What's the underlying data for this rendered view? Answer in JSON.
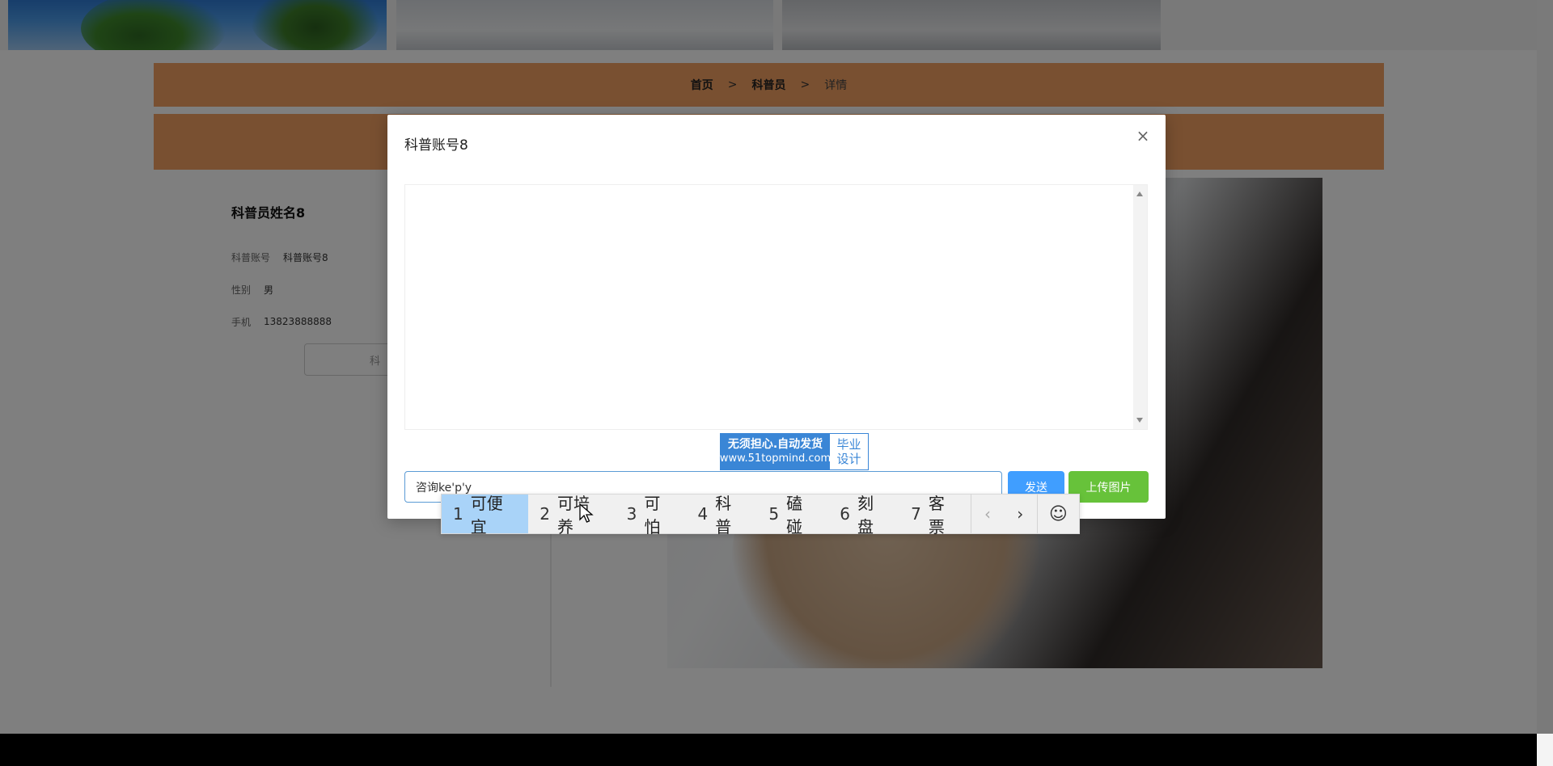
{
  "breadcrumb": {
    "home": "首页",
    "section": "科普员",
    "current": "详情",
    "separator": ">"
  },
  "profile": {
    "name": "科普员姓名8",
    "account_label": "科普账号",
    "account_value": "科普账号8",
    "gender_label": "性别",
    "gender_value": "男",
    "phone_label": "手机",
    "phone_value": "13823888888",
    "button_label": "科"
  },
  "modal": {
    "title": "科普账号8",
    "close_glyph": "×",
    "watermark": {
      "line1": "无须担心.自动发货",
      "line2": "www.51topmind.com",
      "right1": "毕业",
      "right2": "设计"
    },
    "input_value": "咨询ke'p'y",
    "send_label": "发送",
    "upload_label": "上传图片"
  },
  "ime": {
    "candidates": [
      {
        "num": "1",
        "text": "可便宜",
        "selected": true
      },
      {
        "num": "2",
        "text": "可培养",
        "selected": false
      },
      {
        "num": "3",
        "text": "可怕",
        "selected": false
      },
      {
        "num": "4",
        "text": "科普",
        "selected": false
      },
      {
        "num": "5",
        "text": "磕碰",
        "selected": false
      },
      {
        "num": "6",
        "text": "刻盘",
        "selected": false
      },
      {
        "num": "7",
        "text": "客票",
        "selected": false
      }
    ],
    "prev_glyph": "‹",
    "next_glyph": "›",
    "emoji_glyph": "☺"
  },
  "colors": {
    "accent_orange": "#f2a063",
    "send_blue": "#409eff",
    "upload_green": "#67c23a",
    "ime_selected": "#a9d3f8"
  }
}
